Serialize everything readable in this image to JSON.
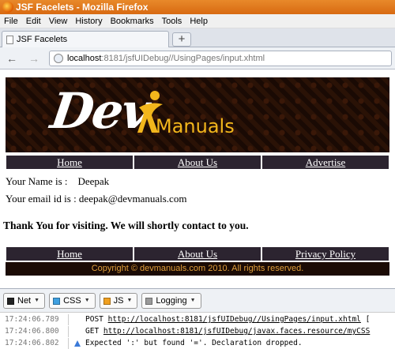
{
  "window": {
    "title": "JSF Facelets - Mozilla Firefox"
  },
  "menu": [
    "File",
    "Edit",
    "View",
    "History",
    "Bookmarks",
    "Tools",
    "Help"
  ],
  "tab": {
    "title": "JSF Facelets",
    "new_tab": "+"
  },
  "nav": {
    "back": "←",
    "forward": "→",
    "url_host": "localhost",
    "url_rest": ":8181/jsfUIDebug//UsingPages/input.xhtml"
  },
  "page": {
    "logo": {
      "text_dev": "Dev",
      "text_manuals": "Manuals"
    },
    "top_nav": [
      "Home",
      "About Us",
      "Advertise"
    ],
    "name_line": "Your Name is :    Deepak",
    "email_line": "Your email id is : deepak@devmanuals.com",
    "thanks": "Thank You for visiting. We will shortly contact to you.",
    "bottom_nav": [
      "Home",
      "About Us",
      "Privacy Policy"
    ],
    "copyright": "Copyright © devmanuals.com 2010. All rights reserved."
  },
  "devtools": {
    "filters": [
      {
        "label": "Net",
        "color": "#222222"
      },
      {
        "label": "CSS",
        "color": "#3fa0e0"
      },
      {
        "label": "JS",
        "color": "#f0a020"
      },
      {
        "label": "Logging",
        "color": "#9a9a9a"
      }
    ],
    "log": [
      {
        "time": "17:24:06.789",
        "msg": "POST ",
        "link": "http://localhost:8181/jsfUIDebug//UsingPages/input.xhtml",
        "suffix": " [",
        "warn": false
      },
      {
        "time": "17:24:06.800",
        "msg": "GET ",
        "link": "http://localhost:8181/jsfUIDebug/javax.faces.resource/myCSS",
        "suffix": "",
        "warn": false
      },
      {
        "time": "17:24:06.802",
        "msg": "Expected ':' but found '='.  Declaration dropped.",
        "link": "",
        "suffix": "",
        "warn": true
      }
    ]
  }
}
